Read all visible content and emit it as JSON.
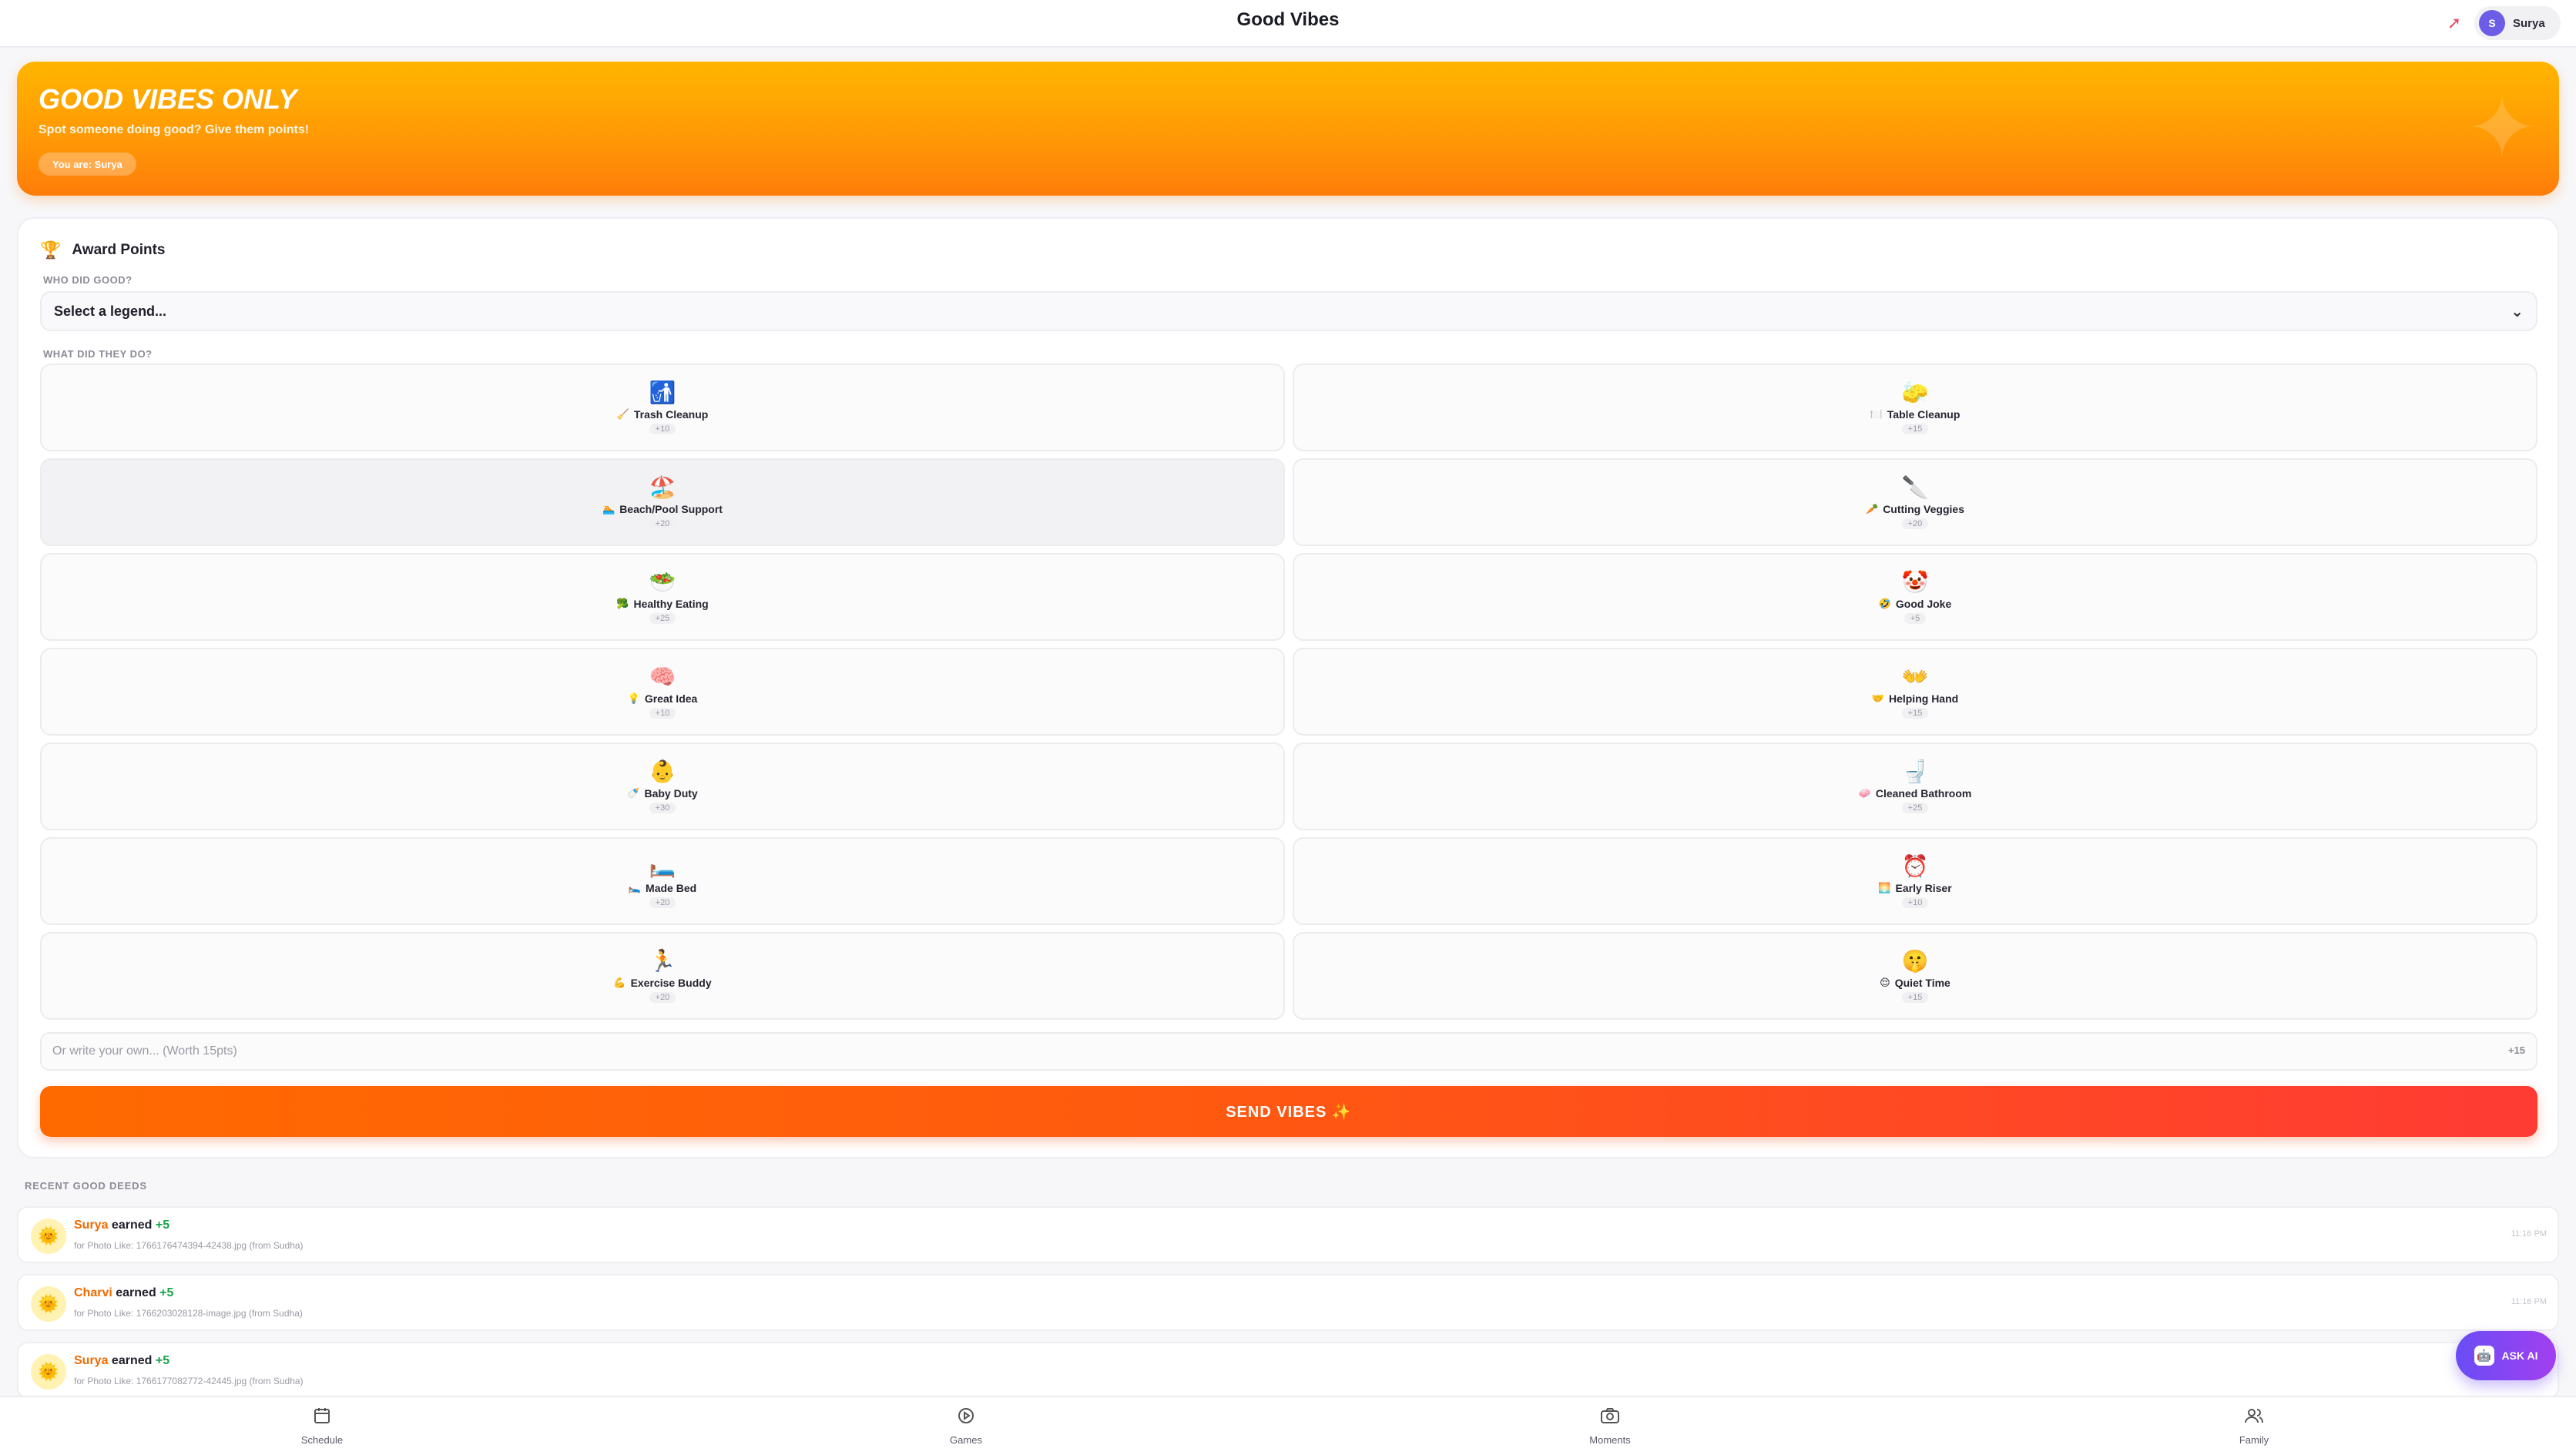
{
  "header": {
    "title": "Good Vibes",
    "share_icon": "share-arrow-icon",
    "user": {
      "initial": "S",
      "name": "Surya"
    }
  },
  "banner": {
    "title": "GOOD VIBES ONLY",
    "subtitle": "Spot someone doing good? Give them points!",
    "you_are": "You are: Surya"
  },
  "award": {
    "title": "Award Points",
    "icon": "trophy-icon",
    "who_label": "WHO DID GOOD?",
    "select_value": "Select a legend...",
    "what_label": "WHAT DID THEY DO?",
    "deeds": [
      {
        "big": "🚮",
        "small": "🧹",
        "name": "Trash Cleanup",
        "pts": "+10"
      },
      {
        "big": "🧽",
        "small": "🍽️",
        "name": "Table Cleanup",
        "pts": "+15"
      },
      {
        "big": "🏖️",
        "small": "🏊",
        "name": "Beach/Pool Support",
        "pts": "+20"
      },
      {
        "big": "🔪",
        "small": "🥕",
        "name": "Cutting Veggies",
        "pts": "+20"
      },
      {
        "big": "🥗",
        "small": "🥦",
        "name": "Healthy Eating",
        "pts": "+25"
      },
      {
        "big": "🤡",
        "small": "🤣",
        "name": "Good Joke",
        "pts": "+5"
      },
      {
        "big": "🧠",
        "small": "💡",
        "name": "Great Idea",
        "pts": "+10"
      },
      {
        "big": "👐",
        "small": "🤝",
        "name": "Helping Hand",
        "pts": "+15"
      },
      {
        "big": "👶",
        "small": "🍼",
        "name": "Baby Duty",
        "pts": "+30"
      },
      {
        "big": "🚽",
        "small": "🧼",
        "name": "Cleaned Bathroom",
        "pts": "+25"
      },
      {
        "big": "🛏️",
        "small": "🛌",
        "name": "Made Bed",
        "pts": "+20"
      },
      {
        "big": "⏰",
        "small": "🌅",
        "name": "Early Riser",
        "pts": "+10"
      },
      {
        "big": "🏃",
        "small": "💪",
        "name": "Exercise Buddy",
        "pts": "+20"
      },
      {
        "big": "🤫",
        "small": "😌",
        "name": "Quiet Time",
        "pts": "+15"
      }
    ],
    "custom_placeholder": "Or write your own... (Worth 15pts)",
    "custom_points": "+15",
    "send_label": "SEND VIBES ✨"
  },
  "recent": {
    "title": "RECENT GOOD DEEDS",
    "items": [
      {
        "who": "Surya",
        "earned": "earned",
        "amount": "+5",
        "detail": "for Photo Like: 1766176474394-42438.jpg (from Sudha)",
        "time": "11:16 PM"
      },
      {
        "who": "Charvi",
        "earned": "earned",
        "amount": "+5",
        "detail": "for Photo Like: 1766203028128-image.jpg (from Sudha)",
        "time": "11:16 PM"
      },
      {
        "who": "Surya",
        "earned": "earned",
        "amount": "+5",
        "detail": "for Photo Like: 1766177082772-42445.jpg (from Sudha)",
        "time": ""
      }
    ]
  },
  "ask_ai": {
    "label": "ASK AI"
  },
  "nav": [
    {
      "label": "Schedule",
      "icon": "calendar-icon"
    },
    {
      "label": "Games",
      "icon": "play-circle-icon"
    },
    {
      "label": "Moments",
      "icon": "camera-icon"
    },
    {
      "label": "Family",
      "icon": "people-icon"
    }
  ]
}
